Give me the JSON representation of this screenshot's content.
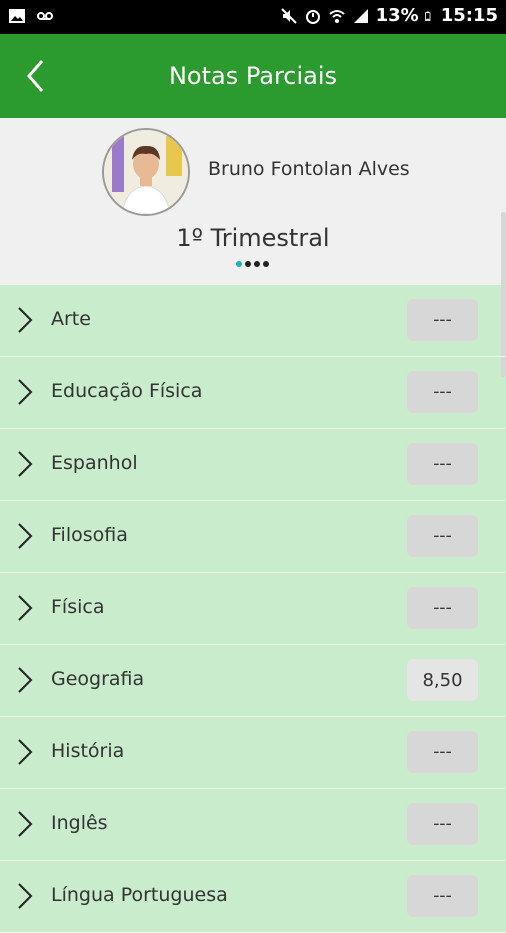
{
  "statusbar": {
    "battery": "13%",
    "time": "15:15"
  },
  "appbar": {
    "title": "Notas Parciais"
  },
  "profile": {
    "name": "Bruno Fontolan Alves",
    "period": "1º Trimestral"
  },
  "colors": {
    "appbar": "#2b9b2f",
    "list_bg": "#c8eccc",
    "active_dot": "#18b8b8"
  },
  "subjects": [
    {
      "name": "Arte",
      "grade": "---"
    },
    {
      "name": "Educação Física",
      "grade": "---"
    },
    {
      "name": "Espanhol",
      "grade": "---"
    },
    {
      "name": "Filosofia",
      "grade": "---"
    },
    {
      "name": "Física",
      "grade": "---"
    },
    {
      "name": "Geografia",
      "grade": "8,50"
    },
    {
      "name": "História",
      "grade": "---"
    },
    {
      "name": "Inglês",
      "grade": "---"
    },
    {
      "name": "Língua Portuguesa",
      "grade": "---"
    }
  ]
}
